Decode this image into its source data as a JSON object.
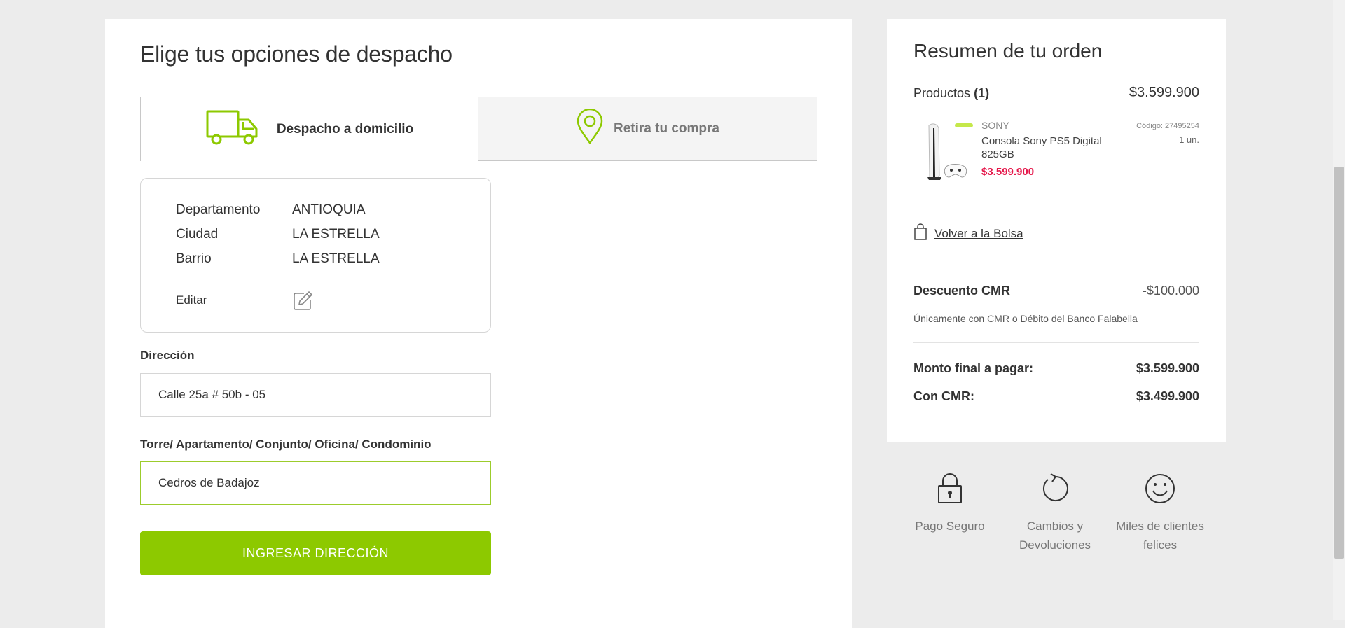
{
  "shipping": {
    "title": "Elige tus opciones de despacho",
    "tabs": [
      {
        "label": "Despacho a domicilio",
        "icon": "truck-icon",
        "active": true
      },
      {
        "label": "Retira tu compra",
        "icon": "location-pin-icon",
        "active": false
      }
    ],
    "location": {
      "rows": [
        {
          "key": "Departamento",
          "value": "ANTIOQUIA"
        },
        {
          "key": "Ciudad",
          "value": "LA ESTRELLA"
        },
        {
          "key": "Barrio",
          "value": "LA ESTRELLA"
        }
      ],
      "edit_label": "Editar"
    },
    "address": {
      "label": "Dirección",
      "value": "Calle 25a # 50b - 05"
    },
    "complement": {
      "label": "Torre/ Apartamento/ Conjunto/ Oficina/ Condominio",
      "value": "Cedros de Badajoz"
    },
    "submit_label": "INGRESAR DIRECCIÓN"
  },
  "summary": {
    "title": "Resumen de tu orden",
    "products_label": "Productos",
    "products_count": "(1)",
    "products_total": "$3.599.900",
    "product": {
      "brand": "SONY",
      "name": "Consola Sony PS5 Digital 825GB",
      "price": "$3.599.900",
      "code": "Código: 27495254",
      "qty": "1 un."
    },
    "back_label": "Volver a la Bolsa",
    "discount": {
      "label": "Descuento CMR",
      "value": "-$100.000",
      "note": "Únicamente con CMR o Débito del Banco Falabella"
    },
    "final_label": "Monto final a pagar:",
    "final_value": "$3.599.900",
    "cmr_label": "Con CMR:",
    "cmr_value": "$3.499.900"
  },
  "trust": [
    {
      "icon": "padlock-icon",
      "label": "Pago Seguro"
    },
    {
      "icon": "refresh-icon",
      "label": "Cambios y Devoluciones"
    },
    {
      "icon": "smiley-icon",
      "label": "Miles de clientes felices"
    }
  ],
  "colors": {
    "accent": "#8dc900",
    "price": "#e5174a",
    "focus_border": "#9ccc2c"
  }
}
